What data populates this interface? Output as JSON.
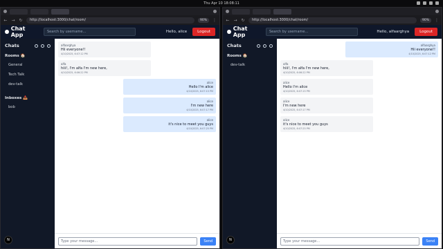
{
  "system": {
    "clock": "Thu Apr 10  18:08:11"
  },
  "left": {
    "url": "http://localhost:3000/chat/room/",
    "zoom": "90%",
    "app": {
      "title": "Chat App",
      "search_placeholder": "Search by username...",
      "greeting": "Hello, alice",
      "logout": "Logout",
      "sidebar": {
        "chats": "Chats",
        "rooms_title": "Rooms 🏠",
        "rooms": [
          "General",
          "Tech Talk",
          "dev-talk"
        ],
        "inboxes_title": "Inboxes 📥",
        "inboxes": [
          "bob"
        ]
      },
      "messages": [
        {
          "side": "other",
          "who": "alfaarghya",
          "text": "Hii everyone!!",
          "ts": "4/10/2025, 6:07:12 PM"
        },
        {
          "side": "other",
          "who": "alfa",
          "text": "hiii!, I'm alfa I'm new here,",
          "ts": "4/10/2025, 6:06:22 PM"
        },
        {
          "side": "me",
          "who": "alice",
          "text": "Hello I'm alice",
          "ts": "4/10/2025, 6:07:15 PM"
        },
        {
          "side": "me",
          "who": "alice",
          "text": "I'm new here",
          "ts": "4/10/2025, 6:07:17 PM"
        },
        {
          "side": "me",
          "who": "alice",
          "text": "it's nice to meet you guys",
          "ts": "4/10/2025, 6:07:25 PM"
        }
      ],
      "composer_placeholder": "Type your message...",
      "send": "Send"
    }
  },
  "right": {
    "url": "http://localhost:3000/chat/room/",
    "zoom": "90%",
    "app": {
      "title": "Chat App",
      "search_placeholder": "Search by username...",
      "greeting": "Hello, alfaarghya",
      "logout": "Logout",
      "sidebar": {
        "chats": "Chats",
        "rooms_title": "Rooms 🏠",
        "rooms": [
          "dev-talk"
        ]
      },
      "messages": [
        {
          "side": "me",
          "who": "alfaarghya",
          "text": "Hii everyone!!",
          "ts": "4/10/2025, 6:07:12 PM"
        },
        {
          "side": "other",
          "who": "alfa",
          "text": "hiii!, I'm alfa I'm new here,",
          "ts": "4/10/2025, 6:06:22 PM"
        },
        {
          "side": "other",
          "who": "alice",
          "text": "Hello I'm alice",
          "ts": "4/10/2025, 6:07:15 PM"
        },
        {
          "side": "other",
          "who": "alice",
          "text": "I'm new here",
          "ts": "4/10/2025, 6:07:17 PM"
        },
        {
          "side": "other",
          "who": "alice",
          "text": "it's nice to meet you guys",
          "ts": "4/10/2025, 6:07:25 PM"
        }
      ],
      "composer_placeholder": "Type your message...",
      "send": "Send"
    }
  },
  "avatar_initial": "N"
}
